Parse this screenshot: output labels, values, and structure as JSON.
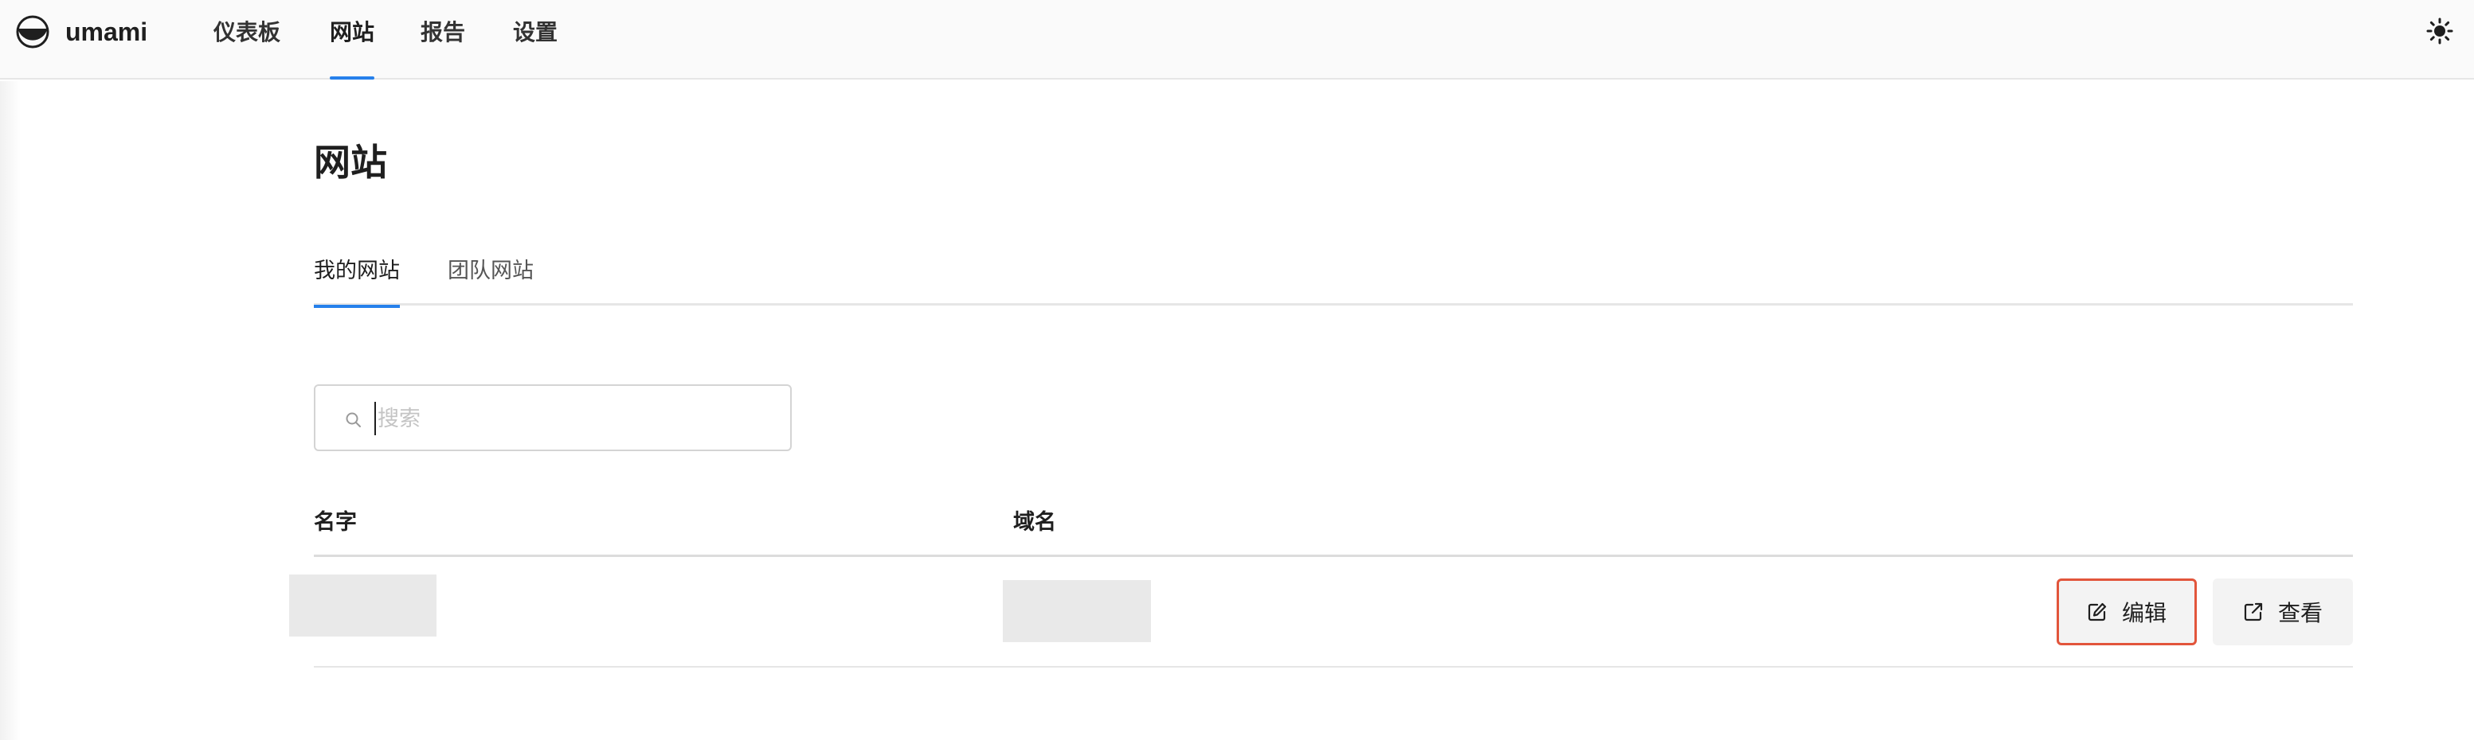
{
  "app": {
    "name": "umami"
  },
  "nav": {
    "items": [
      {
        "label": "仪表板"
      },
      {
        "label": "网站"
      },
      {
        "label": "报告"
      },
      {
        "label": "设置"
      }
    ]
  },
  "page": {
    "title": "网站"
  },
  "tabs": [
    {
      "label": "我的网站"
    },
    {
      "label": "团队网站"
    }
  ],
  "search": {
    "placeholder": "搜索",
    "value": ""
  },
  "table": {
    "columns": [
      "名字",
      "域名"
    ],
    "rows": [
      {
        "name": "",
        "domain": "",
        "actions": {
          "edit": "编辑",
          "view": "查看"
        }
      }
    ]
  },
  "colors": {
    "accent": "#2680eb",
    "highlight": "#e2553b"
  },
  "icons": [
    "umami-logo-icon",
    "sun-icon",
    "search-icon",
    "edit-icon",
    "external-link-icon"
  ]
}
